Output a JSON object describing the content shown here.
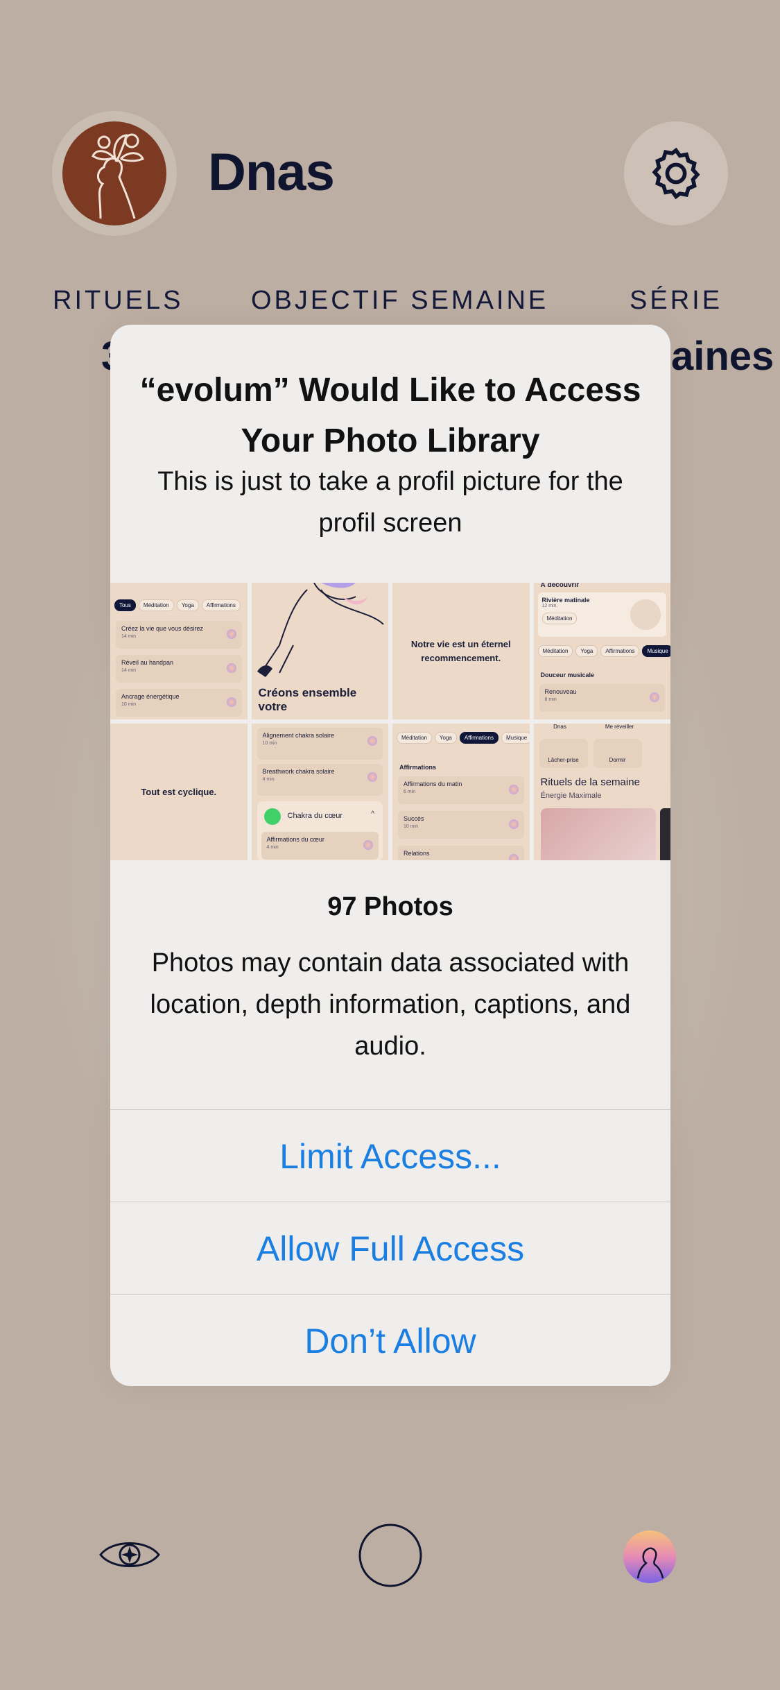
{
  "profile": {
    "name": "Dnas"
  },
  "stats": {
    "labels": [
      "RITUELS",
      "OBJECTIF SEMAINE",
      "SÉRIE"
    ],
    "rituels_value_partial": "3",
    "serie_value_partial": "aines"
  },
  "alert": {
    "title": "“evolum” Would Like to Access Your Photo Library",
    "message": "This is just to take a profil picture for the profil screen",
    "photos_count": "97 Photos",
    "photos_note": "Photos may contain data associated with location, depth information, captions, and audio.",
    "buttons": {
      "limit": "Limit Access...",
      "allow": "Allow Full Access",
      "deny": "Don’t Allow"
    }
  },
  "thumbnails": {
    "t1": {
      "pills": [
        "Tous",
        "Méditation",
        "Yoga",
        "Affirmations"
      ],
      "cards": [
        {
          "title": "Créez la vie que vous désirez",
          "sub": "14 min"
        },
        {
          "title": "Réveil au handpan",
          "sub": "14 min"
        },
        {
          "title": "Ancrage énergétique",
          "sub": "10 min"
        }
      ]
    },
    "t2": {
      "text": "Créons ensemble votre"
    },
    "t3": {
      "text": "Notre vie est un éternel recommencement."
    },
    "t4": {
      "header": "À découvrir",
      "card_title": "Rivière matinale",
      "card_sub": "12 min.",
      "tag": "Méditation",
      "pills": [
        "Méditation",
        "Yoga",
        "Affirmations",
        "Musique"
      ],
      "section": "Douceur musicale",
      "item": "Renouveau",
      "item_sub": "8 min"
    },
    "t5": {
      "text": "Tout est cyclique."
    },
    "t6": {
      "cards": [
        {
          "title": "Alignement chakra solaire",
          "sub": "10 min"
        },
        {
          "title": "Breathwork chakra solaire",
          "sub": "4 min"
        }
      ],
      "chakra": "Chakra du cœur",
      "chakra_item": "Affirmations du cœur",
      "chakra_item_sub": "4 min"
    },
    "t7": {
      "pills": [
        "Méditation",
        "Yoga",
        "Affirmations",
        "Musique"
      ],
      "section": "Affirmations",
      "cards": [
        {
          "title": "Affirmations du matin",
          "sub": "6 min"
        },
        {
          "title": "Succès",
          "sub": "10 min"
        },
        {
          "title": "Relations",
          "sub": ""
        }
      ]
    },
    "t8": {
      "top_items": [
        "Dnas",
        "Me réveiller"
      ],
      "actions": [
        "Lâcher-prise",
        "Dormir"
      ],
      "title": "Rituels de la semaine",
      "subtitle": "Énergie Maximale"
    }
  },
  "tabbar": {
    "icons": [
      "eye-icon",
      "circle-home-icon",
      "profile-avatar-icon"
    ]
  }
}
